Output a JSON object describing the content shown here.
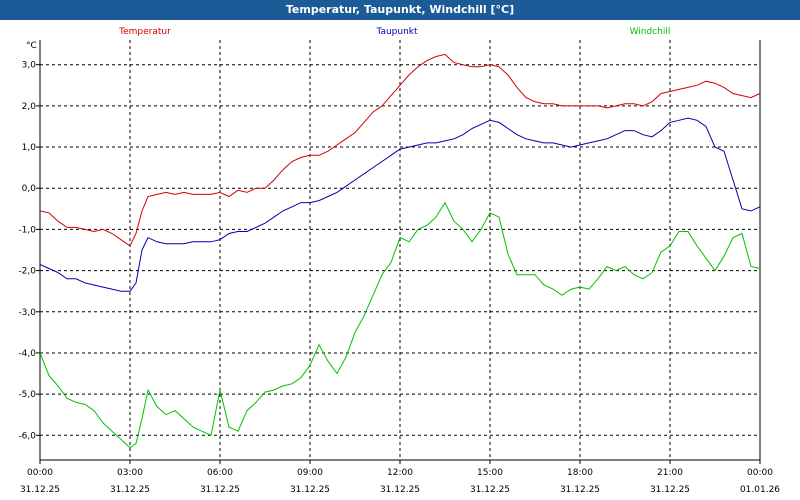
{
  "window": {
    "title": "Temperatur, Taupunkt, Windchill [°C]"
  },
  "chart_data": {
    "type": "line",
    "title": "Temperatur, Taupunkt, Windchill [°C]",
    "ylabel": "°C",
    "ylim": [
      -6.6,
      3.6
    ],
    "yticks": [
      3.0,
      2.0,
      1.0,
      0.0,
      -1.0,
      -2.0,
      -3.0,
      -4.0,
      -5.0,
      -6.0
    ],
    "ytick_labels": [
      "3,0",
      "2,0",
      "1,0",
      "0,0",
      "-1,0",
      "-2,0",
      "-3,0",
      "-4,0",
      "-5,0",
      "-6,0"
    ],
    "xlim": [
      0,
      24
    ],
    "xticks": [
      0,
      3,
      6,
      9,
      12,
      15,
      18,
      21,
      24
    ],
    "xtick_labels": [
      [
        "00:00",
        "31.12.25"
      ],
      [
        "03:00",
        "31.12.25"
      ],
      [
        "06:00",
        "31.12.25"
      ],
      [
        "09:00",
        "31.12.25"
      ],
      [
        "12:00",
        "31.12.25"
      ],
      [
        "15:00",
        "31.12.25"
      ],
      [
        "18:00",
        "31.12.25"
      ],
      [
        "21:00",
        "31.12.25"
      ],
      [
        "00:00",
        "01.01.26"
      ]
    ],
    "grid": true,
    "legend_position": "top",
    "series": [
      {
        "name": "Temperatur",
        "color": "#d40000",
        "points": [
          [
            0.0,
            -0.55
          ],
          [
            0.3,
            -0.6
          ],
          [
            0.6,
            -0.8
          ],
          [
            0.9,
            -0.95
          ],
          [
            1.2,
            -0.95
          ],
          [
            1.5,
            -1.0
          ],
          [
            1.8,
            -1.05
          ],
          [
            2.1,
            -1.0
          ],
          [
            2.4,
            -1.1
          ],
          [
            2.7,
            -1.25
          ],
          [
            3.0,
            -1.4
          ],
          [
            3.2,
            -1.1
          ],
          [
            3.4,
            -0.55
          ],
          [
            3.6,
            -0.2
          ],
          [
            3.9,
            -0.15
          ],
          [
            4.2,
            -0.1
          ],
          [
            4.5,
            -0.15
          ],
          [
            4.8,
            -0.1
          ],
          [
            5.1,
            -0.15
          ],
          [
            5.4,
            -0.15
          ],
          [
            5.7,
            -0.15
          ],
          [
            6.0,
            -0.1
          ],
          [
            6.3,
            -0.2
          ],
          [
            6.6,
            -0.05
          ],
          [
            6.9,
            -0.1
          ],
          [
            7.2,
            0.0
          ],
          [
            7.5,
            0.0
          ],
          [
            7.8,
            0.2
          ],
          [
            8.1,
            0.45
          ],
          [
            8.4,
            0.65
          ],
          [
            8.7,
            0.75
          ],
          [
            9.0,
            0.8
          ],
          [
            9.3,
            0.8
          ],
          [
            9.6,
            0.9
          ],
          [
            9.9,
            1.05
          ],
          [
            10.2,
            1.2
          ],
          [
            10.5,
            1.35
          ],
          [
            10.8,
            1.6
          ],
          [
            11.1,
            1.85
          ],
          [
            11.4,
            2.0
          ],
          [
            11.7,
            2.25
          ],
          [
            12.0,
            2.5
          ],
          [
            12.3,
            2.75
          ],
          [
            12.6,
            2.95
          ],
          [
            12.9,
            3.1
          ],
          [
            13.2,
            3.2
          ],
          [
            13.5,
            3.25
          ],
          [
            13.8,
            3.05
          ],
          [
            14.1,
            3.0
          ],
          [
            14.4,
            2.95
          ],
          [
            14.7,
            2.95
          ],
          [
            15.0,
            3.0
          ],
          [
            15.3,
            2.95
          ],
          [
            15.6,
            2.75
          ],
          [
            15.9,
            2.45
          ],
          [
            16.2,
            2.2
          ],
          [
            16.5,
            2.1
          ],
          [
            16.8,
            2.05
          ],
          [
            17.1,
            2.05
          ],
          [
            17.4,
            2.0
          ],
          [
            17.7,
            2.0
          ],
          [
            18.0,
            2.0
          ],
          [
            18.3,
            2.0
          ],
          [
            18.6,
            2.0
          ],
          [
            18.9,
            1.95
          ],
          [
            19.2,
            2.0
          ],
          [
            19.5,
            2.05
          ],
          [
            19.8,
            2.05
          ],
          [
            20.1,
            2.0
          ],
          [
            20.4,
            2.1
          ],
          [
            20.7,
            2.3
          ],
          [
            21.0,
            2.35
          ],
          [
            21.3,
            2.4
          ],
          [
            21.6,
            2.45
          ],
          [
            21.9,
            2.5
          ],
          [
            22.2,
            2.6
          ],
          [
            22.5,
            2.55
          ],
          [
            22.8,
            2.45
          ],
          [
            23.1,
            2.3
          ],
          [
            23.4,
            2.25
          ],
          [
            23.7,
            2.2
          ],
          [
            24.0,
            2.3
          ]
        ]
      },
      {
        "name": "Taupunkt",
        "color": "#0000b4",
        "points": [
          [
            0.0,
            -1.85
          ],
          [
            0.3,
            -1.95
          ],
          [
            0.6,
            -2.05
          ],
          [
            0.9,
            -2.2
          ],
          [
            1.2,
            -2.2
          ],
          [
            1.5,
            -2.3
          ],
          [
            1.8,
            -2.35
          ],
          [
            2.1,
            -2.4
          ],
          [
            2.4,
            -2.45
          ],
          [
            2.7,
            -2.5
          ],
          [
            3.0,
            -2.5
          ],
          [
            3.2,
            -2.3
          ],
          [
            3.4,
            -1.5
          ],
          [
            3.6,
            -1.2
          ],
          [
            3.9,
            -1.3
          ],
          [
            4.2,
            -1.35
          ],
          [
            4.5,
            -1.35
          ],
          [
            4.8,
            -1.35
          ],
          [
            5.1,
            -1.3
          ],
          [
            5.4,
            -1.3
          ],
          [
            5.7,
            -1.3
          ],
          [
            6.0,
            -1.25
          ],
          [
            6.3,
            -1.1
          ],
          [
            6.6,
            -1.05
          ],
          [
            6.9,
            -1.05
          ],
          [
            7.2,
            -0.95
          ],
          [
            7.5,
            -0.85
          ],
          [
            7.8,
            -0.7
          ],
          [
            8.1,
            -0.55
          ],
          [
            8.4,
            -0.45
          ],
          [
            8.7,
            -0.35
          ],
          [
            9.0,
            -0.35
          ],
          [
            9.3,
            -0.3
          ],
          [
            9.6,
            -0.2
          ],
          [
            9.9,
            -0.1
          ],
          [
            10.2,
            0.05
          ],
          [
            10.5,
            0.2
          ],
          [
            10.8,
            0.35
          ],
          [
            11.1,
            0.5
          ],
          [
            11.4,
            0.65
          ],
          [
            11.7,
            0.8
          ],
          [
            12.0,
            0.95
          ],
          [
            12.3,
            1.0
          ],
          [
            12.6,
            1.05
          ],
          [
            12.9,
            1.1
          ],
          [
            13.2,
            1.1
          ],
          [
            13.5,
            1.15
          ],
          [
            13.8,
            1.2
          ],
          [
            14.1,
            1.3
          ],
          [
            14.4,
            1.45
          ],
          [
            14.7,
            1.55
          ],
          [
            15.0,
            1.65
          ],
          [
            15.3,
            1.6
          ],
          [
            15.6,
            1.45
          ],
          [
            15.9,
            1.3
          ],
          [
            16.2,
            1.2
          ],
          [
            16.5,
            1.15
          ],
          [
            16.8,
            1.1
          ],
          [
            17.1,
            1.1
          ],
          [
            17.4,
            1.05
          ],
          [
            17.7,
            1.0
          ],
          [
            18.0,
            1.05
          ],
          [
            18.3,
            1.1
          ],
          [
            18.6,
            1.15
          ],
          [
            18.9,
            1.2
          ],
          [
            19.2,
            1.3
          ],
          [
            19.5,
            1.4
          ],
          [
            19.8,
            1.4
          ],
          [
            20.1,
            1.3
          ],
          [
            20.4,
            1.25
          ],
          [
            20.7,
            1.4
          ],
          [
            21.0,
            1.6
          ],
          [
            21.3,
            1.65
          ],
          [
            21.6,
            1.7
          ],
          [
            21.9,
            1.65
          ],
          [
            22.2,
            1.5
          ],
          [
            22.5,
            1.0
          ],
          [
            22.8,
            0.9
          ],
          [
            23.1,
            0.2
          ],
          [
            23.4,
            -0.5
          ],
          [
            23.7,
            -0.55
          ],
          [
            24.0,
            -0.45
          ]
        ]
      },
      {
        "name": "Windchill",
        "color": "#00c000",
        "points": [
          [
            0.0,
            -4.0
          ],
          [
            0.3,
            -4.55
          ],
          [
            0.6,
            -4.8
          ],
          [
            0.9,
            -5.1
          ],
          [
            1.2,
            -5.2
          ],
          [
            1.5,
            -5.25
          ],
          [
            1.8,
            -5.4
          ],
          [
            2.1,
            -5.7
          ],
          [
            2.4,
            -5.9
          ],
          [
            2.7,
            -6.1
          ],
          [
            3.0,
            -6.3
          ],
          [
            3.2,
            -6.2
          ],
          [
            3.4,
            -5.6
          ],
          [
            3.6,
            -4.9
          ],
          [
            3.9,
            -5.3
          ],
          [
            4.2,
            -5.5
          ],
          [
            4.5,
            -5.4
          ],
          [
            4.8,
            -5.6
          ],
          [
            5.1,
            -5.8
          ],
          [
            5.4,
            -5.9
          ],
          [
            5.7,
            -6.0
          ],
          [
            6.0,
            -4.9
          ],
          [
            6.3,
            -5.8
          ],
          [
            6.6,
            -5.9
          ],
          [
            6.9,
            -5.4
          ],
          [
            7.2,
            -5.2
          ],
          [
            7.5,
            -4.95
          ],
          [
            7.8,
            -4.9
          ],
          [
            8.1,
            -4.8
          ],
          [
            8.4,
            -4.75
          ],
          [
            8.7,
            -4.6
          ],
          [
            9.0,
            -4.3
          ],
          [
            9.3,
            -3.8
          ],
          [
            9.6,
            -4.2
          ],
          [
            9.9,
            -4.5
          ],
          [
            10.2,
            -4.1
          ],
          [
            10.5,
            -3.5
          ],
          [
            10.8,
            -3.1
          ],
          [
            11.1,
            -2.6
          ],
          [
            11.4,
            -2.1
          ],
          [
            11.7,
            -1.8
          ],
          [
            12.0,
            -1.2
          ],
          [
            12.3,
            -1.3
          ],
          [
            12.6,
            -1.0
          ],
          [
            12.9,
            -0.9
          ],
          [
            13.2,
            -0.7
          ],
          [
            13.5,
            -0.35
          ],
          [
            13.8,
            -0.8
          ],
          [
            14.1,
            -1.0
          ],
          [
            14.4,
            -1.3
          ],
          [
            14.7,
            -1.0
          ],
          [
            15.0,
            -0.6
          ],
          [
            15.3,
            -0.7
          ],
          [
            15.6,
            -1.6
          ],
          [
            15.9,
            -2.1
          ],
          [
            16.2,
            -2.1
          ],
          [
            16.5,
            -2.1
          ],
          [
            16.8,
            -2.35
          ],
          [
            17.1,
            -2.45
          ],
          [
            17.4,
            -2.6
          ],
          [
            17.7,
            -2.45
          ],
          [
            18.0,
            -2.4
          ],
          [
            18.3,
            -2.45
          ],
          [
            18.6,
            -2.2
          ],
          [
            18.9,
            -1.9
          ],
          [
            19.2,
            -2.0
          ],
          [
            19.5,
            -1.9
          ],
          [
            19.8,
            -2.1
          ],
          [
            20.1,
            -2.2
          ],
          [
            20.4,
            -2.05
          ],
          [
            20.7,
            -1.55
          ],
          [
            21.0,
            -1.4
          ],
          [
            21.3,
            -1.05
          ],
          [
            21.6,
            -1.05
          ],
          [
            21.9,
            -1.4
          ],
          [
            22.2,
            -1.7
          ],
          [
            22.5,
            -2.0
          ],
          [
            22.8,
            -1.65
          ],
          [
            23.1,
            -1.2
          ],
          [
            23.4,
            -1.1
          ],
          [
            23.7,
            -1.9
          ],
          [
            24.0,
            -1.95
          ]
        ]
      }
    ]
  }
}
